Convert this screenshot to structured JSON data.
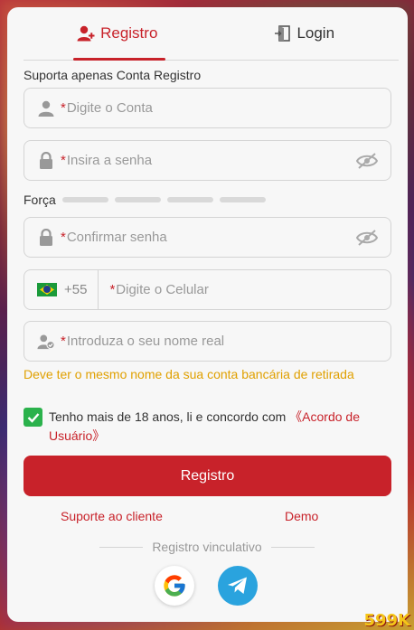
{
  "tabs": [
    {
      "label": "Registro",
      "active": true,
      "icon": "user-plus-icon"
    },
    {
      "label": "Login",
      "active": false,
      "icon": "login-door-icon"
    }
  ],
  "support_note": "Suporta apenas Conta Registro",
  "fields": {
    "account": {
      "required_mark": "*",
      "placeholder": "Digite o Conta",
      "value": ""
    },
    "password": {
      "required_mark": "*",
      "placeholder": "Insira a senha",
      "value": ""
    },
    "confirm_password": {
      "required_mark": "*",
      "placeholder": "Confirmar senha",
      "value": ""
    },
    "phone": {
      "prefix": "+55",
      "required_mark": "*",
      "placeholder": "Digite o Celular",
      "value": ""
    },
    "real_name": {
      "required_mark": "*",
      "placeholder": "Introduza o seu nome real",
      "value": ""
    }
  },
  "strength": {
    "label": "Força",
    "level": 0,
    "segments": 4
  },
  "name_note": "Deve ter o mesmo nome da sua conta bancária de retirada",
  "agreement": {
    "checked": true,
    "text": "Tenho mais de 18 anos, li e concordo com ",
    "link": "《Acordo de Usuário》"
  },
  "submit_label": "Registro",
  "links": {
    "support": "Suporte ao cliente",
    "demo": "Demo"
  },
  "divider_label": "Registro vinculativo",
  "brand": "599K",
  "colors": {
    "accent": "#c8222a",
    "warning": "#e0a000",
    "check": "#2bb24c",
    "telegram": "#2aa3de"
  }
}
